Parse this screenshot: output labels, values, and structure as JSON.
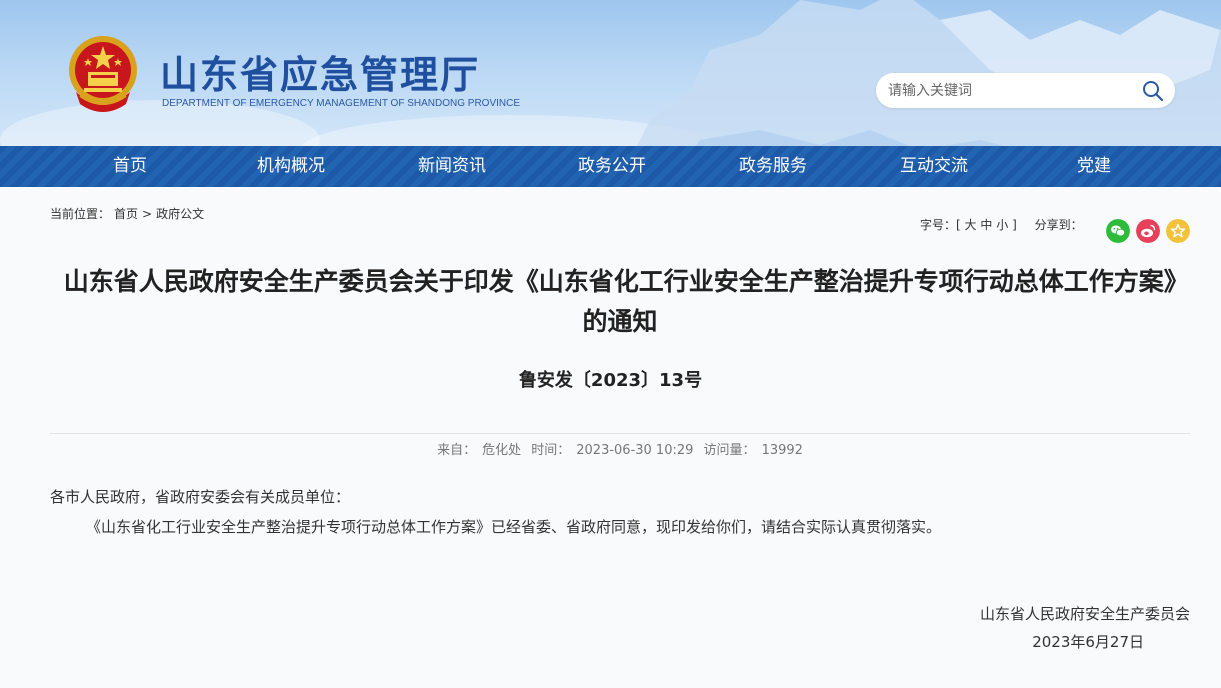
{
  "header": {
    "site_title": "山东省应急管理厅",
    "site_subtitle": "DEPARTMENT OF EMERGENCY MANAGEMENT OF SHANDONG PROVINCE",
    "search_placeholder": "请输入关键词"
  },
  "nav": {
    "items": [
      "首页",
      "机构概况",
      "新闻资讯",
      "政务公开",
      "政务服务",
      "互动交流",
      "党建"
    ]
  },
  "breadcrumb": {
    "prefix": "当前位置：",
    "home": "首页",
    "separator": ">",
    "current": "政府公文"
  },
  "tools": {
    "font_label": "字号：",
    "bracket_open": "[",
    "large": "大",
    "medium": "中",
    "small": "小",
    "bracket_close": "]",
    "share_label": "分享到："
  },
  "article": {
    "title": "山东省人民政府安全生产委员会关于印发《山东省化工行业安全生产整治提升专项行动总体工作方案》的通知",
    "doc_number": "鲁安发〔2023〕13号",
    "meta": {
      "source_label": "来自：",
      "source": "危化处",
      "time_label": "时间：",
      "time": "2023-06-30 10:29",
      "views_label": "访问量：",
      "views": "13992"
    },
    "salutation": "各市人民政府，省政府安委会有关成员单位：",
    "paragraph": "《山东省化工行业安全生产整治提升专项行动总体工作方案》已经省委、省政府同意，现印发给你们，请结合实际认真贯彻落实。",
    "signature": "山东省人民政府安全生产委员会",
    "date": "2023年6月27日"
  },
  "colors": {
    "nav_blue": "#1c5aa8",
    "title_blue": "#1f4f9f",
    "wechat_green": "#2dbb3a",
    "weibo_red": "#e6405a",
    "favorite_yellow": "#f2c23a"
  },
  "icons": [
    "national-emblem-icon",
    "search-icon",
    "wechat-icon",
    "weibo-icon",
    "favorite-icon"
  ]
}
